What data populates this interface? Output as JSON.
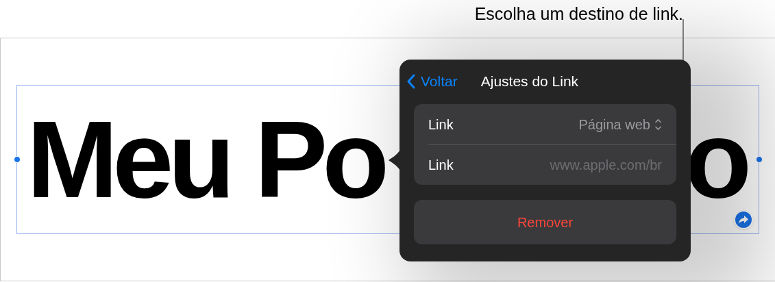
{
  "callout": "Escolha um destino de link.",
  "canvas": {
    "title_start": "Meu Po",
    "title_end": "o"
  },
  "popover": {
    "back": "Voltar",
    "title": "Ajustes do Link",
    "rows": [
      {
        "label": "Link",
        "value": "Página web",
        "kind": "picker"
      },
      {
        "label": "Link",
        "placeholder": "www.apple.com/br",
        "kind": "field"
      }
    ],
    "remove": "Remover"
  }
}
